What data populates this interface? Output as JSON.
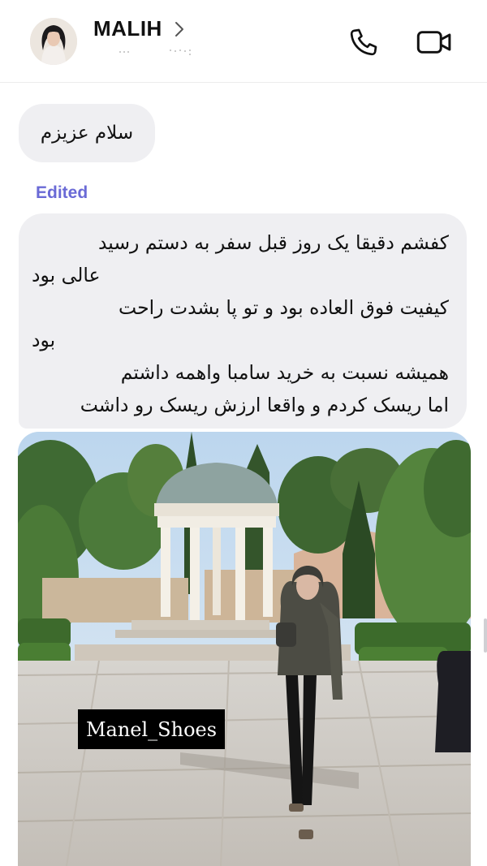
{
  "header": {
    "contact_name": "MALIH",
    "avatar_icon": "avatar-photo",
    "chevron_icon": "chevron-right-icon",
    "call_icon": "phone-icon",
    "video_icon": "video-camera-icon"
  },
  "messages": [
    {
      "text": "سلام عزیزم"
    },
    {
      "status": "Edited",
      "lines": [
        "کفشم دقیقا یک روز قبل سفر به دستم رسید",
        "عالی بود",
        "کیفیت فوق العاده  بود و تو پا بشدت راحت",
        "بود",
        "همیشه نسبت به خرید سامبا واهمه داشتم",
        "اما ریسک کردم و واقعا ارزش ریسک رو داشت"
      ]
    }
  ],
  "photo": {
    "watermark": "Manel_Shoes"
  },
  "colors": {
    "bubble": "#efeff2",
    "edited": "#6a6ad6",
    "text": "#111111"
  }
}
